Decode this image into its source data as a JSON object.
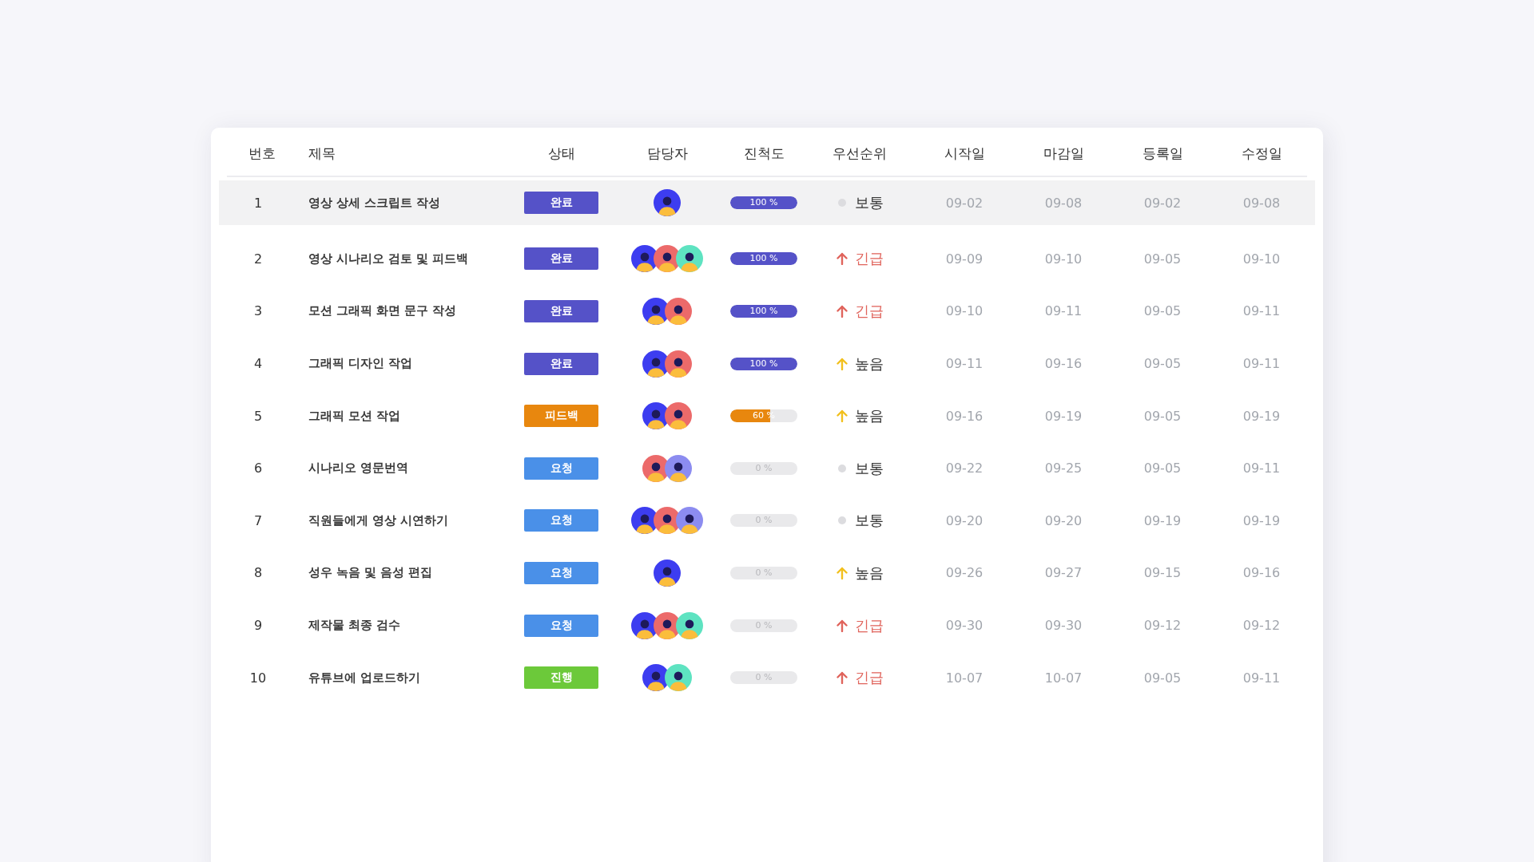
{
  "table": {
    "columns": [
      "번호",
      "제목",
      "상태",
      "담당자",
      "진척도",
      "우선순위",
      "시작일",
      "마감일",
      "등록일",
      "수정일"
    ],
    "rows": [
      {
        "number": "1",
        "title": "영상 상세 스크립트 작성",
        "selected": true,
        "status": {
          "label": "완료",
          "color": "#5552c8"
        },
        "assignees": [
          {
            "color": "#3d3df0"
          }
        ],
        "progress": {
          "label": "100 %",
          "level": 1
        },
        "priority": {
          "kind": "normal",
          "label": "보통"
        },
        "start": "09-02",
        "due": "09-08",
        "registered": "09-02",
        "modified": "09-08"
      },
      {
        "number": "2",
        "title": "영상 시나리오 검토 및 피드백",
        "selected": false,
        "status": {
          "label": "완료",
          "color": "#5552c8"
        },
        "assignees": [
          {
            "color": "#3d3df0"
          },
          {
            "color": "#ec6a6a"
          },
          {
            "color": "#5ee3c1"
          }
        ],
        "progress": {
          "label": "100 %",
          "level": 1
        },
        "priority": {
          "kind": "urgent",
          "label": "긴급"
        },
        "start": "09-09",
        "due": "09-10",
        "registered": "09-05",
        "modified": "09-10"
      },
      {
        "number": "3",
        "title": "모션 그래픽 화면 문구 작성",
        "selected": false,
        "status": {
          "label": "완료",
          "color": "#5552c8"
        },
        "assignees": [
          {
            "color": "#3d3df0"
          },
          {
            "color": "#ec6a6a"
          }
        ],
        "progress": {
          "label": "100 %",
          "level": 1
        },
        "priority": {
          "kind": "urgent",
          "label": "긴급"
        },
        "start": "09-10",
        "due": "09-11",
        "registered": "09-05",
        "modified": "09-11"
      },
      {
        "number": "4",
        "title": "그래픽 디자인 작업",
        "selected": false,
        "status": {
          "label": "완료",
          "color": "#5552c8"
        },
        "assignees": [
          {
            "color": "#3d3df0"
          },
          {
            "color": "#ec6a6a"
          }
        ],
        "progress": {
          "label": "100 %",
          "level": 1
        },
        "priority": {
          "kind": "high",
          "label": "높음"
        },
        "start": "09-11",
        "due": "09-16",
        "registered": "09-05",
        "modified": "09-11"
      },
      {
        "number": "5",
        "title": "그래픽 모션 작업",
        "selected": false,
        "status": {
          "label": "피드백",
          "color": "#e8870e"
        },
        "assignees": [
          {
            "color": "#3d3df0"
          },
          {
            "color": "#ec6a6a"
          }
        ],
        "progress": {
          "label": "60 %",
          "level": 0.6
        },
        "priority": {
          "kind": "high",
          "label": "높음"
        },
        "start": "09-16",
        "due": "09-19",
        "registered": "09-05",
        "modified": "09-19"
      },
      {
        "number": "6",
        "title": "시나리오 영문번역",
        "selected": false,
        "status": {
          "label": "요청",
          "color": "#4a90e8"
        },
        "assignees": [
          {
            "color": "#ec6a6a"
          },
          {
            "color": "#8c8cf0"
          }
        ],
        "progress": {
          "label": "0 %",
          "level": 0
        },
        "priority": {
          "kind": "normal",
          "label": "보통"
        },
        "start": "09-22",
        "due": "09-25",
        "registered": "09-05",
        "modified": "09-11"
      },
      {
        "number": "7",
        "title": "직원들에게 영상 시연하기",
        "selected": false,
        "status": {
          "label": "요청",
          "color": "#4a90e8"
        },
        "assignees": [
          {
            "color": "#3d3df0"
          },
          {
            "color": "#ec6a6a"
          },
          {
            "color": "#8c8cf0"
          }
        ],
        "progress": {
          "label": "0 %",
          "level": 0
        },
        "priority": {
          "kind": "normal",
          "label": "보통"
        },
        "start": "09-20",
        "due": "09-20",
        "registered": "09-19",
        "modified": "09-19"
      },
      {
        "number": "8",
        "title": "성우 녹음 및 음성 편집",
        "selected": false,
        "status": {
          "label": "요청",
          "color": "#4a90e8"
        },
        "assignees": [
          {
            "color": "#3d3df0"
          }
        ],
        "progress": {
          "label": "0 %",
          "level": 0
        },
        "priority": {
          "kind": "high",
          "label": "높음"
        },
        "start": "09-26",
        "due": "09-27",
        "registered": "09-15",
        "modified": "09-16"
      },
      {
        "number": "9",
        "title": "제작물 최종 검수",
        "selected": false,
        "status": {
          "label": "요청",
          "color": "#4a90e8"
        },
        "assignees": [
          {
            "color": "#3d3df0"
          },
          {
            "color": "#ec6a6a"
          },
          {
            "color": "#5ee3c1"
          }
        ],
        "progress": {
          "label": "0 %",
          "level": 0
        },
        "priority": {
          "kind": "urgent",
          "label": "긴급"
        },
        "start": "09-30",
        "due": "09-30",
        "registered": "09-12",
        "modified": "09-12"
      },
      {
        "number": "10",
        "title": "유튜브에 업로드하기",
        "selected": false,
        "status": {
          "label": "진행",
          "color": "#6cc93a"
        },
        "assignees": [
          {
            "color": "#3d3df0"
          },
          {
            "color": "#5ee3c1"
          }
        ],
        "progress": {
          "label": "0 %",
          "level": 0
        },
        "priority": {
          "kind": "urgent",
          "label": "긴급"
        },
        "start": "10-07",
        "due": "10-07",
        "registered": "09-05",
        "modified": "09-11"
      }
    ]
  }
}
